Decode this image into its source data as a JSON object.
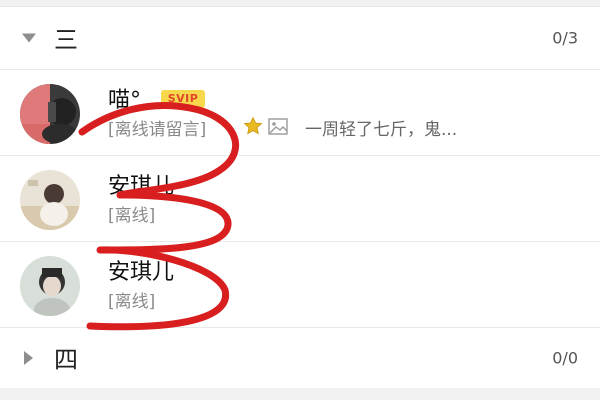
{
  "groups": [
    {
      "name": "三",
      "count": "0/3",
      "expanded": true,
      "contacts": [
        {
          "name": "喵°",
          "badge": "SVIP",
          "status": "[离线请留言]",
          "message": "一周轻了七斤，鬼..."
        },
        {
          "name": "安琪儿",
          "status": "[离线]"
        },
        {
          "name": "安琪儿",
          "status": "[离线]"
        }
      ]
    },
    {
      "name": "四",
      "count": "0/0",
      "expanded": false
    }
  ],
  "icons": {
    "collapse": "triangle-down-icon",
    "expand": "triangle-right-icon",
    "star": "star-icon",
    "image": "image-icon"
  },
  "colors": {
    "vip_badge_bg": "#f7d74b",
    "vip_badge_text": "#e2462a",
    "star": "#e8b923",
    "scribble": "#d81e1e"
  }
}
